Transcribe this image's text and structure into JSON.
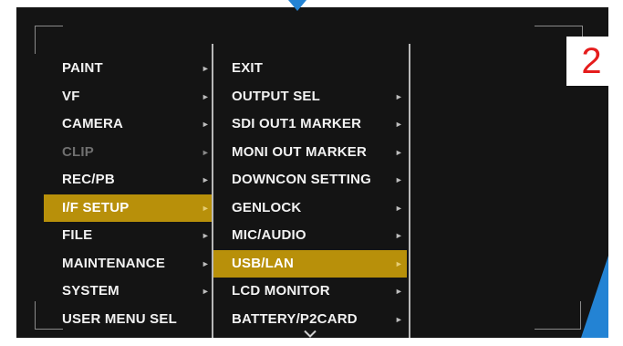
{
  "left_menu": {
    "items": [
      {
        "label": "PAINT",
        "state": "normal"
      },
      {
        "label": "VF",
        "state": "normal"
      },
      {
        "label": "CAMERA",
        "state": "normal"
      },
      {
        "label": "CLIP",
        "state": "disabled"
      },
      {
        "label": "REC/PB",
        "state": "normal"
      },
      {
        "label": "I/F SETUP",
        "state": "selected"
      },
      {
        "label": "FILE",
        "state": "normal"
      },
      {
        "label": "MAINTENANCE",
        "state": "normal"
      },
      {
        "label": "SYSTEM",
        "state": "normal"
      },
      {
        "label": "USER MENU SEL",
        "state": "normal"
      }
    ]
  },
  "right_menu": {
    "items": [
      {
        "label": "EXIT",
        "has_submenu": false
      },
      {
        "label": "OUTPUT SEL",
        "has_submenu": true
      },
      {
        "label": "SDI OUT1 MARKER",
        "has_submenu": true
      },
      {
        "label": "MONI OUT MARKER",
        "has_submenu": true
      },
      {
        "label": "DOWNCON SETTING",
        "has_submenu": true
      },
      {
        "label": "GENLOCK",
        "has_submenu": true
      },
      {
        "label": "MIC/AUDIO",
        "has_submenu": true
      },
      {
        "label": "USB/LAN",
        "has_submenu": true,
        "selected": true
      },
      {
        "label": "LCD MONITOR",
        "has_submenu": true
      },
      {
        "label": "BATTERY/P2CARD",
        "has_submenu": true
      }
    ]
  },
  "step_badge": "2",
  "icons": {
    "submenu_arrow": "triangle-right-icon",
    "scroll_more": "chevron-down-icon",
    "pointer_marker": "triangle-down-icon"
  },
  "colors": {
    "background": "#141414",
    "selection": "#b8900a",
    "badge_text": "#e51c1c",
    "marker_blue": "#2383d4"
  }
}
